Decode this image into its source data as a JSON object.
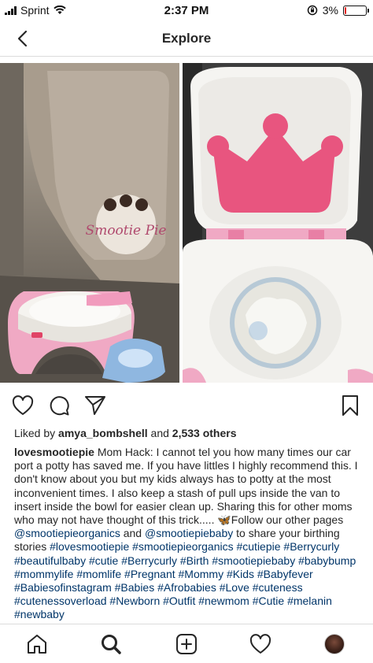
{
  "status_bar": {
    "carrier": "Sprint",
    "time": "2:37 PM",
    "battery_percent": "3%",
    "battery_level": 0.03
  },
  "header": {
    "title": "Explore"
  },
  "post": {
    "image_watermark": "Smootie Pie",
    "likes": {
      "prefix": "Liked by",
      "user": "amya_bombshell",
      "connector": "and",
      "count": "2,533 others"
    },
    "caption": {
      "username": "lovesmootiepie",
      "text": "Mom Hack: I cannot tel you how many times our car port a potty has saved me. If you have littles I highly recommend this. I don't know about you but my kids always has to potty at the most inconvenient times. I also keep a stash of pull ups inside the van to insert inside the bowl for easier clean up. Sharing this for other moms who may not have thought of this trick..... 🦋Follow our other pages",
      "mention1": "@smootiepieorganics",
      "and_text": "and",
      "mention2": "@smootiepiebaby",
      "text2": "to share your birthing stories",
      "hashtags": "#lovesmootiepie #smootiepieorganics #cutiepie #Berrycurly #beautifulbaby #cutie #Berrycurly #Birth #smootiepiebaby #babybump #mommylife #momlife #Pregnant #Mommy #Kids #Babyfever #Babiesofinstagram #Babies #Afrobabies #Love #cuteness #cutenessoverload #Newborn #Outfit #newmom #Cutie #melanin #newbaby"
    }
  },
  "colors": {
    "potty_pink": "#f0a9c4",
    "crown_pink": "#e8557f",
    "link_blue": "#003569",
    "divider": "#dbdbdb"
  },
  "icons": {
    "back": "chevron-left-icon",
    "like": "heart-icon",
    "comment": "comment-icon",
    "share": "paper-plane-icon",
    "save": "bookmark-icon",
    "home": "home-icon",
    "search": "search-icon",
    "add": "plus-square-icon",
    "activity": "heart-icon",
    "profile": "avatar"
  }
}
